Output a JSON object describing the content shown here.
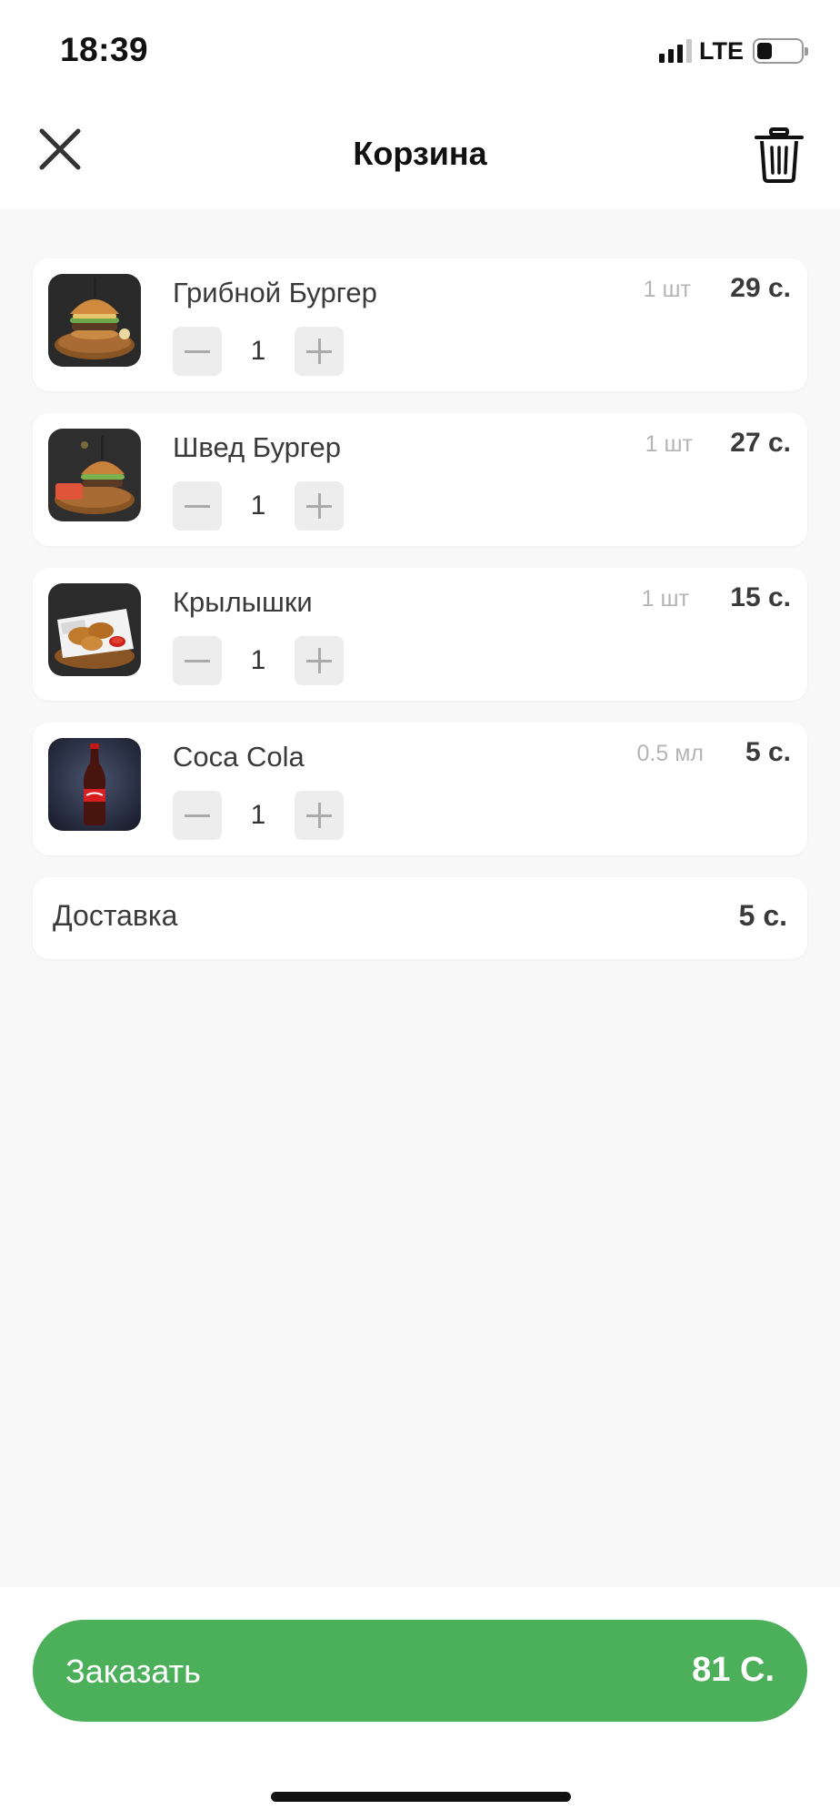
{
  "status_bar": {
    "time": "18:39",
    "network": "LTE",
    "battery_level": 0.35
  },
  "header": {
    "title": "Корзина",
    "close_icon": "close-icon",
    "trash_icon": "trash-icon"
  },
  "cart": {
    "items": [
      {
        "name": "Грибной Бургер",
        "unit": "1 шт",
        "price": "29 с.",
        "quantity": "1",
        "image": "mushroom-burger"
      },
      {
        "name": "Швед Бургер",
        "unit": "1 шт",
        "price": "27 с.",
        "quantity": "1",
        "image": "swede-burger"
      },
      {
        "name": "Крылышки",
        "unit": "1 шт",
        "price": "15 с.",
        "quantity": "1",
        "image": "chicken-wings"
      },
      {
        "name": "Coca Cola",
        "unit": "0.5 мл",
        "price": "5 с.",
        "quantity": "1",
        "image": "coca-cola-bottle"
      }
    ],
    "delivery": {
      "label": "Доставка",
      "price": "5 с."
    }
  },
  "order_button": {
    "label": "Заказать",
    "total": "81 С."
  },
  "colors": {
    "accent": "#4caf5a",
    "background": "#f8f8f8",
    "card": "#ffffff",
    "muted_text": "#b5b5b5"
  }
}
